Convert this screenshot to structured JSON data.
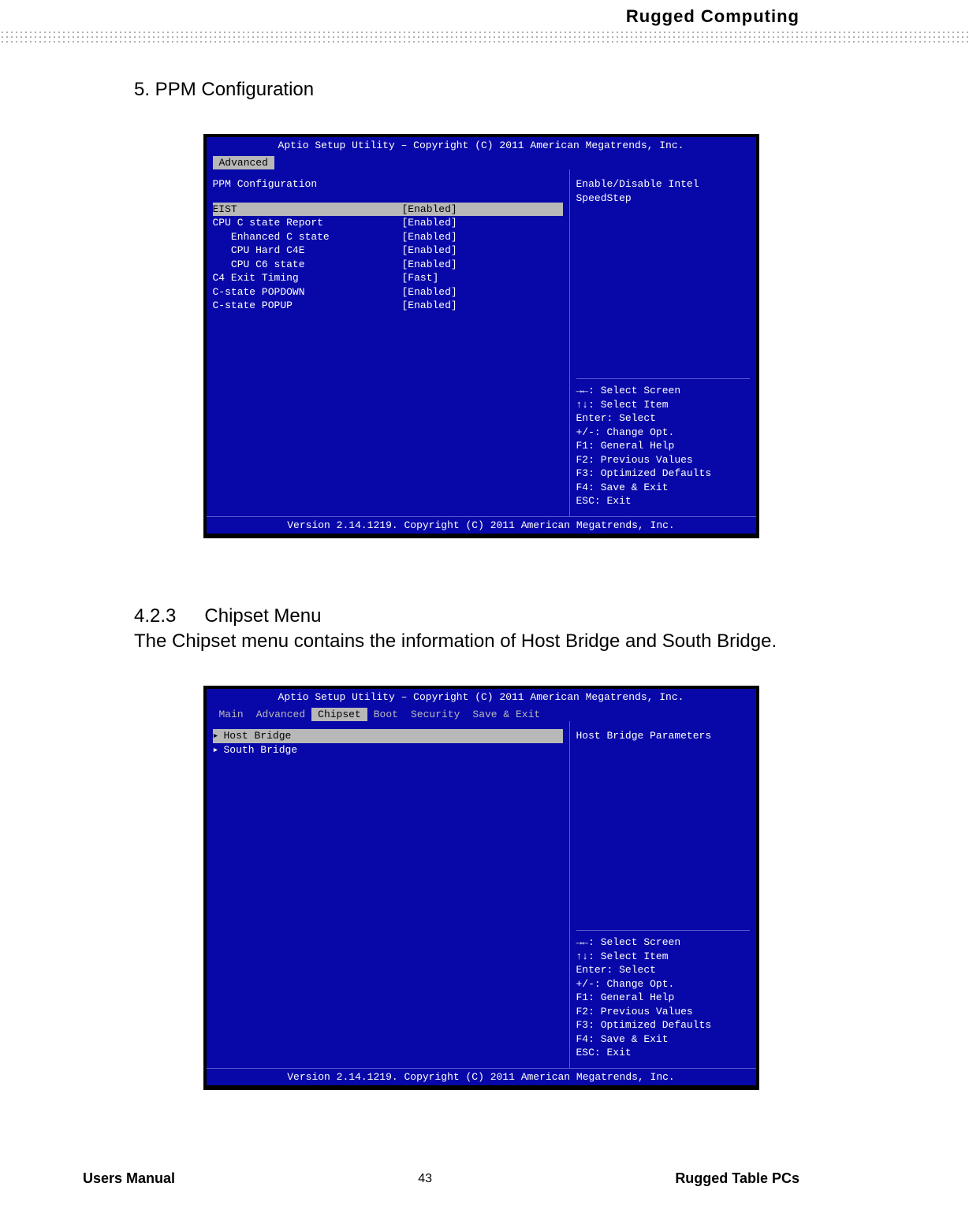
{
  "header": {
    "title": "Rugged  Computing"
  },
  "section5": {
    "title": "5.  PPM Configuration"
  },
  "bios1": {
    "title": "Aptio Setup Utility – Copyright (C) 2011 American Megatrends, Inc.",
    "tab_active": "Advanced",
    "group_label": "PPM Configuration",
    "settings": [
      {
        "label": "EIST",
        "value": "[Enabled]",
        "selected": true
      },
      {
        "label": "CPU C state Report",
        "value": "[Enabled]"
      },
      {
        "label": "   Enhanced C state",
        "value": "[Enabled]"
      },
      {
        "label": "   CPU Hard C4E",
        "value": "[Enabled]"
      },
      {
        "label": "   CPU C6 state",
        "value": "[Enabled]"
      },
      {
        "label": "C4 Exit Timing",
        "value": "[Fast]"
      },
      {
        "label": "C-state POPDOWN",
        "value": "[Enabled]"
      },
      {
        "label": "C-state POPUP",
        "value": "[Enabled]"
      }
    ],
    "right_desc": "Enable/Disable Intel SpeedStep",
    "help": "→←: Select Screen\n↑↓: Select Item\nEnter: Select\n+/-: Change Opt.\nF1: General Help\nF2: Previous Values\nF3: Optimized Defaults\nF4: Save & Exit\nESC: Exit",
    "footer": "Version 2.14.1219. Copyright (C) 2011 American Megatrends, Inc."
  },
  "section423": {
    "num": "4.2.3",
    "title": "Chipset Menu",
    "para": "The Chipset menu contains the information of Host Bridge and South Bridge."
  },
  "bios2": {
    "title": "Aptio Setup Utility – Copyright (C) 2011 American Megatrends, Inc.",
    "tabs": [
      "Main",
      "Advanced",
      "Chipset",
      "Boot",
      "Security",
      "Save & Exit"
    ],
    "active_tab_index": 2,
    "menu": [
      {
        "label": "Host Bridge",
        "selected": true
      },
      {
        "label": "South Bridge"
      }
    ],
    "right_desc": "Host Bridge Parameters",
    "help": "→←: Select Screen\n↑↓: Select Item\nEnter: Select\n+/-: Change Opt.\nF1: General Help\nF2: Previous Values\nF3: Optimized Defaults\nF4: Save & Exit\nESC: Exit",
    "footer": "Version 2.14.1219. Copyright (C) 2011 American Megatrends, Inc."
  },
  "footer": {
    "left": "Users Manual",
    "page": "43",
    "right": "Rugged Table PCs"
  }
}
